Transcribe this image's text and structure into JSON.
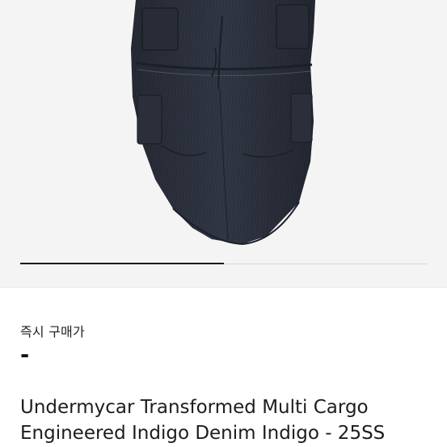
{
  "product": {
    "image_icon": "cargo-pants-photo",
    "gallery_progress": 0.5,
    "price_label": "즉시 구매가",
    "price_value": "-",
    "title_line1": "Undermycar Transformed Multi Cargo",
    "title_line2": "Engineered Indigo Denim Indigo - 25SS"
  },
  "colors": {
    "gallery_bg": "#f4f4f4",
    "denim": "#2e3340",
    "progress_fill": "#1a1a1a"
  }
}
